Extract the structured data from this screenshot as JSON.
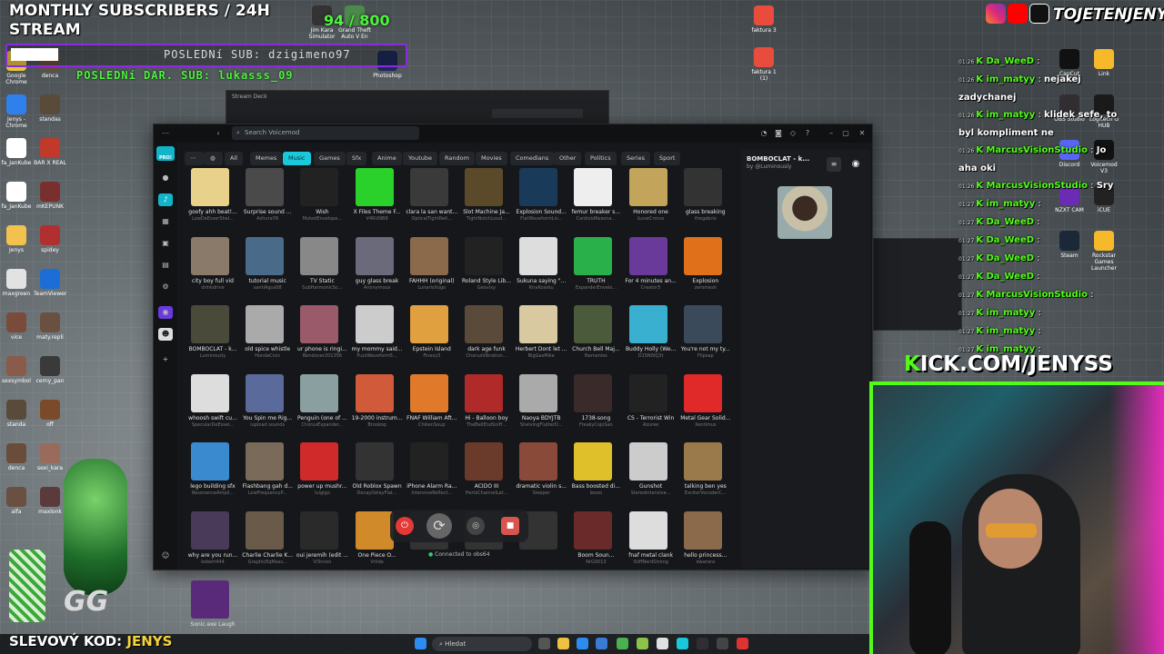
{
  "overlay": {
    "title_line1": "MONTHLY SUBSCRIBERS / 24H",
    "title_line2": "STREAM",
    "counter": "94 / 800",
    "last_sub": "POSLEDNí SUB: dzigimeno97",
    "last_donation": "POSLEDNí DAR. SUB: lukasss_09",
    "kick_prefix": "K",
    "kick_url": "ICK.COM/JENYSS",
    "social_handle": "TOJETENJENYS",
    "promo_label": "SLEVOVÝ KOD:",
    "promo_code": "JENYS"
  },
  "desktop_left": [
    {
      "label": "Google Chrome",
      "color": "#e8c53a"
    },
    {
      "label": "denca",
      "color": "#6a4c3b"
    },
    {
      "label": "Jenys - Chrome",
      "color": "#2f80ed"
    },
    {
      "label": "standas",
      "color": "#5a4a3a"
    },
    {
      "label": "fa_JanKube",
      "color": "#ffffff"
    },
    {
      "label": "BAR X REAL",
      "color": "#c0392b"
    },
    {
      "label": "fa_JanKube",
      "color": "#ffffff"
    },
    {
      "label": "mKEPUNK",
      "color": "#7a2f2f"
    },
    {
      "label": "Jenys",
      "color": "#f2c14e"
    },
    {
      "label": "spidey",
      "color": "#b03030"
    },
    {
      "label": "maxgreen",
      "color": "#e2e2e2"
    },
    {
      "label": "TeamViewer",
      "color": "#1c6ed6"
    },
    {
      "label": "vice",
      "color": "#7a4a3a"
    },
    {
      "label": "maty.repli",
      "color": "#6a5040"
    },
    {
      "label": "sexsymbol",
      "color": "#8a5a4a"
    },
    {
      "label": "cerny_pan",
      "color": "#3a3a3a"
    },
    {
      "label": "standa",
      "color": "#5a4a3a"
    },
    {
      "label": "off",
      "color": "#7a4a2a"
    },
    {
      "label": "denca",
      "color": "#6a4c3b"
    },
    {
      "label": "sexi_kara",
      "color": "#9a6a5a"
    },
    {
      "label": "alfa",
      "color": "#6a5040"
    },
    {
      "label": "maxlonk",
      "color": "#5a3a3a"
    }
  ],
  "desktop_top": [
    {
      "label": "Jim Kara Simulator",
      "color": "#333"
    },
    {
      "label": "Grand Theft Auto V En",
      "color": "#4a8a4a"
    },
    {
      "label": "Photoshop",
      "color": "#1b2a5a"
    }
  ],
  "desktop_files": [
    {
      "label": "faktura 3",
      "color": "#e74c3c"
    },
    {
      "label": "faktura 1 (1)",
      "color": "#e74c3c"
    }
  ],
  "desktop_right": [
    {
      "label": "CapCut",
      "color": "#111"
    },
    {
      "label": "Link",
      "color": "#f5b92a"
    },
    {
      "label": "OBS Studio",
      "color": "#302e31"
    },
    {
      "label": "Logitech G HUB",
      "color": "#1a1a1a"
    },
    {
      "label": "Discord",
      "color": "#5865f2"
    },
    {
      "label": "Voicemod V3",
      "color": "#111"
    },
    {
      "label": "NZXT CAM",
      "color": "#6b2bb5"
    },
    {
      "label": "iCUE",
      "color": "#222"
    },
    {
      "label": "Steam",
      "color": "#1b2838"
    },
    {
      "label": "Rockstar Games Launcher",
      "color": "#f5b92a"
    }
  ],
  "stream_deck_title": "Stream Deck",
  "voicemod": {
    "search_placeholder": "Search Voicemod",
    "logo_text": "PRO!",
    "categories": [
      "All",
      "Memes",
      "Music",
      "Games",
      "Sfx",
      "Anime",
      "Youtube",
      "Random",
      "Movies",
      "Comedians",
      "Other",
      "Politics",
      "Series",
      "Sport"
    ],
    "active_category": "Music",
    "sounds": [
      [
        "goofy ahh beat!...",
        "LowDeEsserShel...",
        "#e8d18a"
      ],
      [
        "Surprise sound ...",
        "AshuraYR",
        "#4a4a4a"
      ],
      [
        "Wish",
        "MutedEnvelope...",
        "#222"
      ],
      [
        "X Files Theme F...",
        "V4RUNB8",
        "#2ad12a"
      ],
      [
        "clara la san want...",
        "OpticalTightRetl...",
        "#3a3a3a"
      ],
      [
        "Slot Machine Ja...",
        "TightNotchLoud...",
        "#5a4a2a"
      ],
      [
        "Explosion Sound...",
        "FlatWaveformLiv...",
        "#1a3a5a"
      ],
      [
        "femur breaker s...",
        "CardioidResona...",
        "#eee"
      ],
      [
        "Honored one",
        "iLoveCrorus",
        "#c2a55a"
      ],
      [
        "glass breaking",
        "thegabrio",
        "#333"
      ],
      [
        "city boy full vid",
        "drinkdrive",
        "#8a7a6a"
      ],
      [
        "tutorial music",
        "santiAgus08",
        "#4a6a8a"
      ],
      [
        "TV Static",
        "SubHarmonicSc...",
        "#888"
      ],
      [
        "guy glass break",
        "Anonymous",
        "#6a6a7a"
      ],
      [
        "FAHHH (original)",
        "LunarisXogo",
        "#8a6a4a"
      ],
      [
        "Roland Style Lib...",
        "Geovixy",
        "#222"
      ],
      [
        "Sukuna saying \"...",
        "KiraKossku",
        "#ddd"
      ],
      [
        "TRUTH",
        "ExpanderEnvelo...",
        "#2ab04a"
      ],
      [
        "For 4 minutes an...",
        "Creator5",
        "#6a3a9a"
      ],
      [
        "Explosion",
        "zeromesh",
        "#e0701a"
      ],
      [
        "BOMBOCLAT - k...",
        "Luminously",
        "#4a4a3a"
      ],
      [
        "old spice whistle",
        "HondaCivic",
        "#aaa"
      ],
      [
        "ur phone is ringi...",
        "Bendover201356",
        "#9a5a6a"
      ],
      [
        "my mommy said...",
        "FuzzWaveform5...",
        "#ccc"
      ],
      [
        "Epstein Island",
        "Finesy3",
        "#e0a040"
      ],
      [
        "dark age funk",
        "ChorusVibration...",
        "#5a4a3a"
      ],
      [
        "Herbert Dont let ...",
        "BigGasMike",
        "#d9c9a0"
      ],
      [
        "Church Bell Maj...",
        "Namenlos",
        "#4a5a3a"
      ],
      [
        "Buddy Holly (We...",
        "D15N0tÇ0t",
        "#3ab0d0"
      ],
      [
        "You're not my ty...",
        "Flipsap",
        "#3a4a5a"
      ],
      [
        "whoosh swift cu...",
        "SpecularDeEsser...",
        "#ddd"
      ],
      [
        "You Spin me Rig...",
        "iupload sounds",
        "#5a6a9a"
      ],
      [
        "Penguin (one of ...",
        "ChorusExpander...",
        "#8aa0a0"
      ],
      [
        "19-2000 instrum...",
        "Brookop",
        "#d05a3a"
      ],
      [
        "FNAF William Aft...",
        "ChikenSoup",
        "#e07a2a"
      ],
      [
        "Hi - Balloon boy",
        "TheBellEndSniff...",
        "#b02a2a"
      ],
      [
        "Naoya BDYJTB",
        "ShelvingFlutterD...",
        "#aaa"
      ],
      [
        "1738-song",
        "FreakyCojoSan",
        "#3a2a2a"
      ],
      [
        "CS - Terrorist Win",
        "Azuree",
        "#222"
      ],
      [
        "Metal Gear Solid...",
        "Xentimus",
        "#e02a2a"
      ],
      [
        "lego building sfx",
        "ResonanceAmpli...",
        "#3a8ad0"
      ],
      [
        "Flashbang gah d...",
        "LowFrequencyP...",
        "#7a6a5a"
      ],
      [
        "power up mushr...",
        "luigigo",
        "#d02a2a"
      ],
      [
        "Old Roblox Spawn",
        "DecayDelayFlat...",
        "#333"
      ],
      [
        "iPhone Alarm Ra...",
        "IntensiveReflect...",
        "#222"
      ],
      [
        "ACIDO III",
        "HertzChannelLat...",
        "#6a3a2a"
      ],
      [
        "dramatic violin s...",
        "Sleeper",
        "#8a4a3a"
      ],
      [
        "Bass boosted di...",
        "leooo",
        "#e0c02a"
      ],
      [
        "Gunshot",
        "StereoIntensive...",
        "#ccc"
      ],
      [
        "talking ben yes",
        "ExciterVocoderC...",
        "#9a7a4a"
      ],
      [
        "why are you run...",
        "kobert444",
        "#4a3a5a"
      ],
      [
        "Charlie Charlie K...",
        "GraphicEqMass...",
        "#6a5a4a"
      ],
      [
        "oui jeremih (edit ...",
        "Vl3ncon",
        "#2a2a2a"
      ],
      [
        "One Piece O...",
        "Vrilde",
        "#d08a2a"
      ],
      [
        "",
        "",
        "#333"
      ],
      [
        "",
        "",
        "#333"
      ],
      [
        "",
        "",
        "#333"
      ],
      [
        "Boom Soun...",
        "NrG0013",
        "#6a2a2a"
      ],
      [
        "fnaf metal clank",
        "StiffNerdStrong",
        "#ddd"
      ],
      [
        "hello princess...",
        "dwarara",
        "#8a6a4a"
      ],
      [
        "Sonic.exe Laugh",
        "MoodPoweddEs...",
        "#5a2a7a"
      ]
    ],
    "selected": {
      "title": "BOMBOCLAT - k...",
      "by": "by @Luminously"
    },
    "status": "Connected to obs64"
  },
  "chat": [
    {
      "time": "01:26",
      "user": "Da_WeeD",
      "color": "#53fc18",
      "msg": ""
    },
    {
      "time": "01:26",
      "user": "im_matyy",
      "color": "#53fc18",
      "msg": "nejakej zadychanej"
    },
    {
      "time": "01:26",
      "user": "im_matyy",
      "color": "#53fc18",
      "msg": "klidek sefe, to byl kompliment ne"
    },
    {
      "time": "01:26",
      "user": "MarcusVisionStudio",
      "color": "#53fc18",
      "msg": "Jo aha oki"
    },
    {
      "time": "01:26",
      "user": "MarcusVisionStudio",
      "color": "#53fc18",
      "msg": "Sry"
    },
    {
      "time": "01:27",
      "user": "im_matyy",
      "color": "#53fc18",
      "msg": ""
    },
    {
      "time": "01:27",
      "user": "Da_WeeD",
      "color": "#53fc18",
      "msg": ""
    },
    {
      "time": "01:27",
      "user": "Da_WeeD",
      "color": "#53fc18",
      "msg": ""
    },
    {
      "time": "01:27",
      "user": "Da_WeeD",
      "color": "#53fc18",
      "msg": ""
    },
    {
      "time": "01:27",
      "user": "Da_WeeD",
      "color": "#53fc18",
      "msg": ""
    },
    {
      "time": "01:27",
      "user": "MarcusVisionStudio",
      "color": "#53fc18",
      "msg": ""
    },
    {
      "time": "01:27",
      "user": "im_matyy",
      "color": "#53fc18",
      "msg": ""
    },
    {
      "time": "01:27",
      "user": "im_matyy",
      "color": "#53fc18",
      "msg": ""
    },
    {
      "time": "01:27",
      "user": "im_matyy",
      "color": "#53fc18",
      "msg": ""
    }
  ],
  "taskbar": {
    "search_placeholder": "Hledat"
  }
}
